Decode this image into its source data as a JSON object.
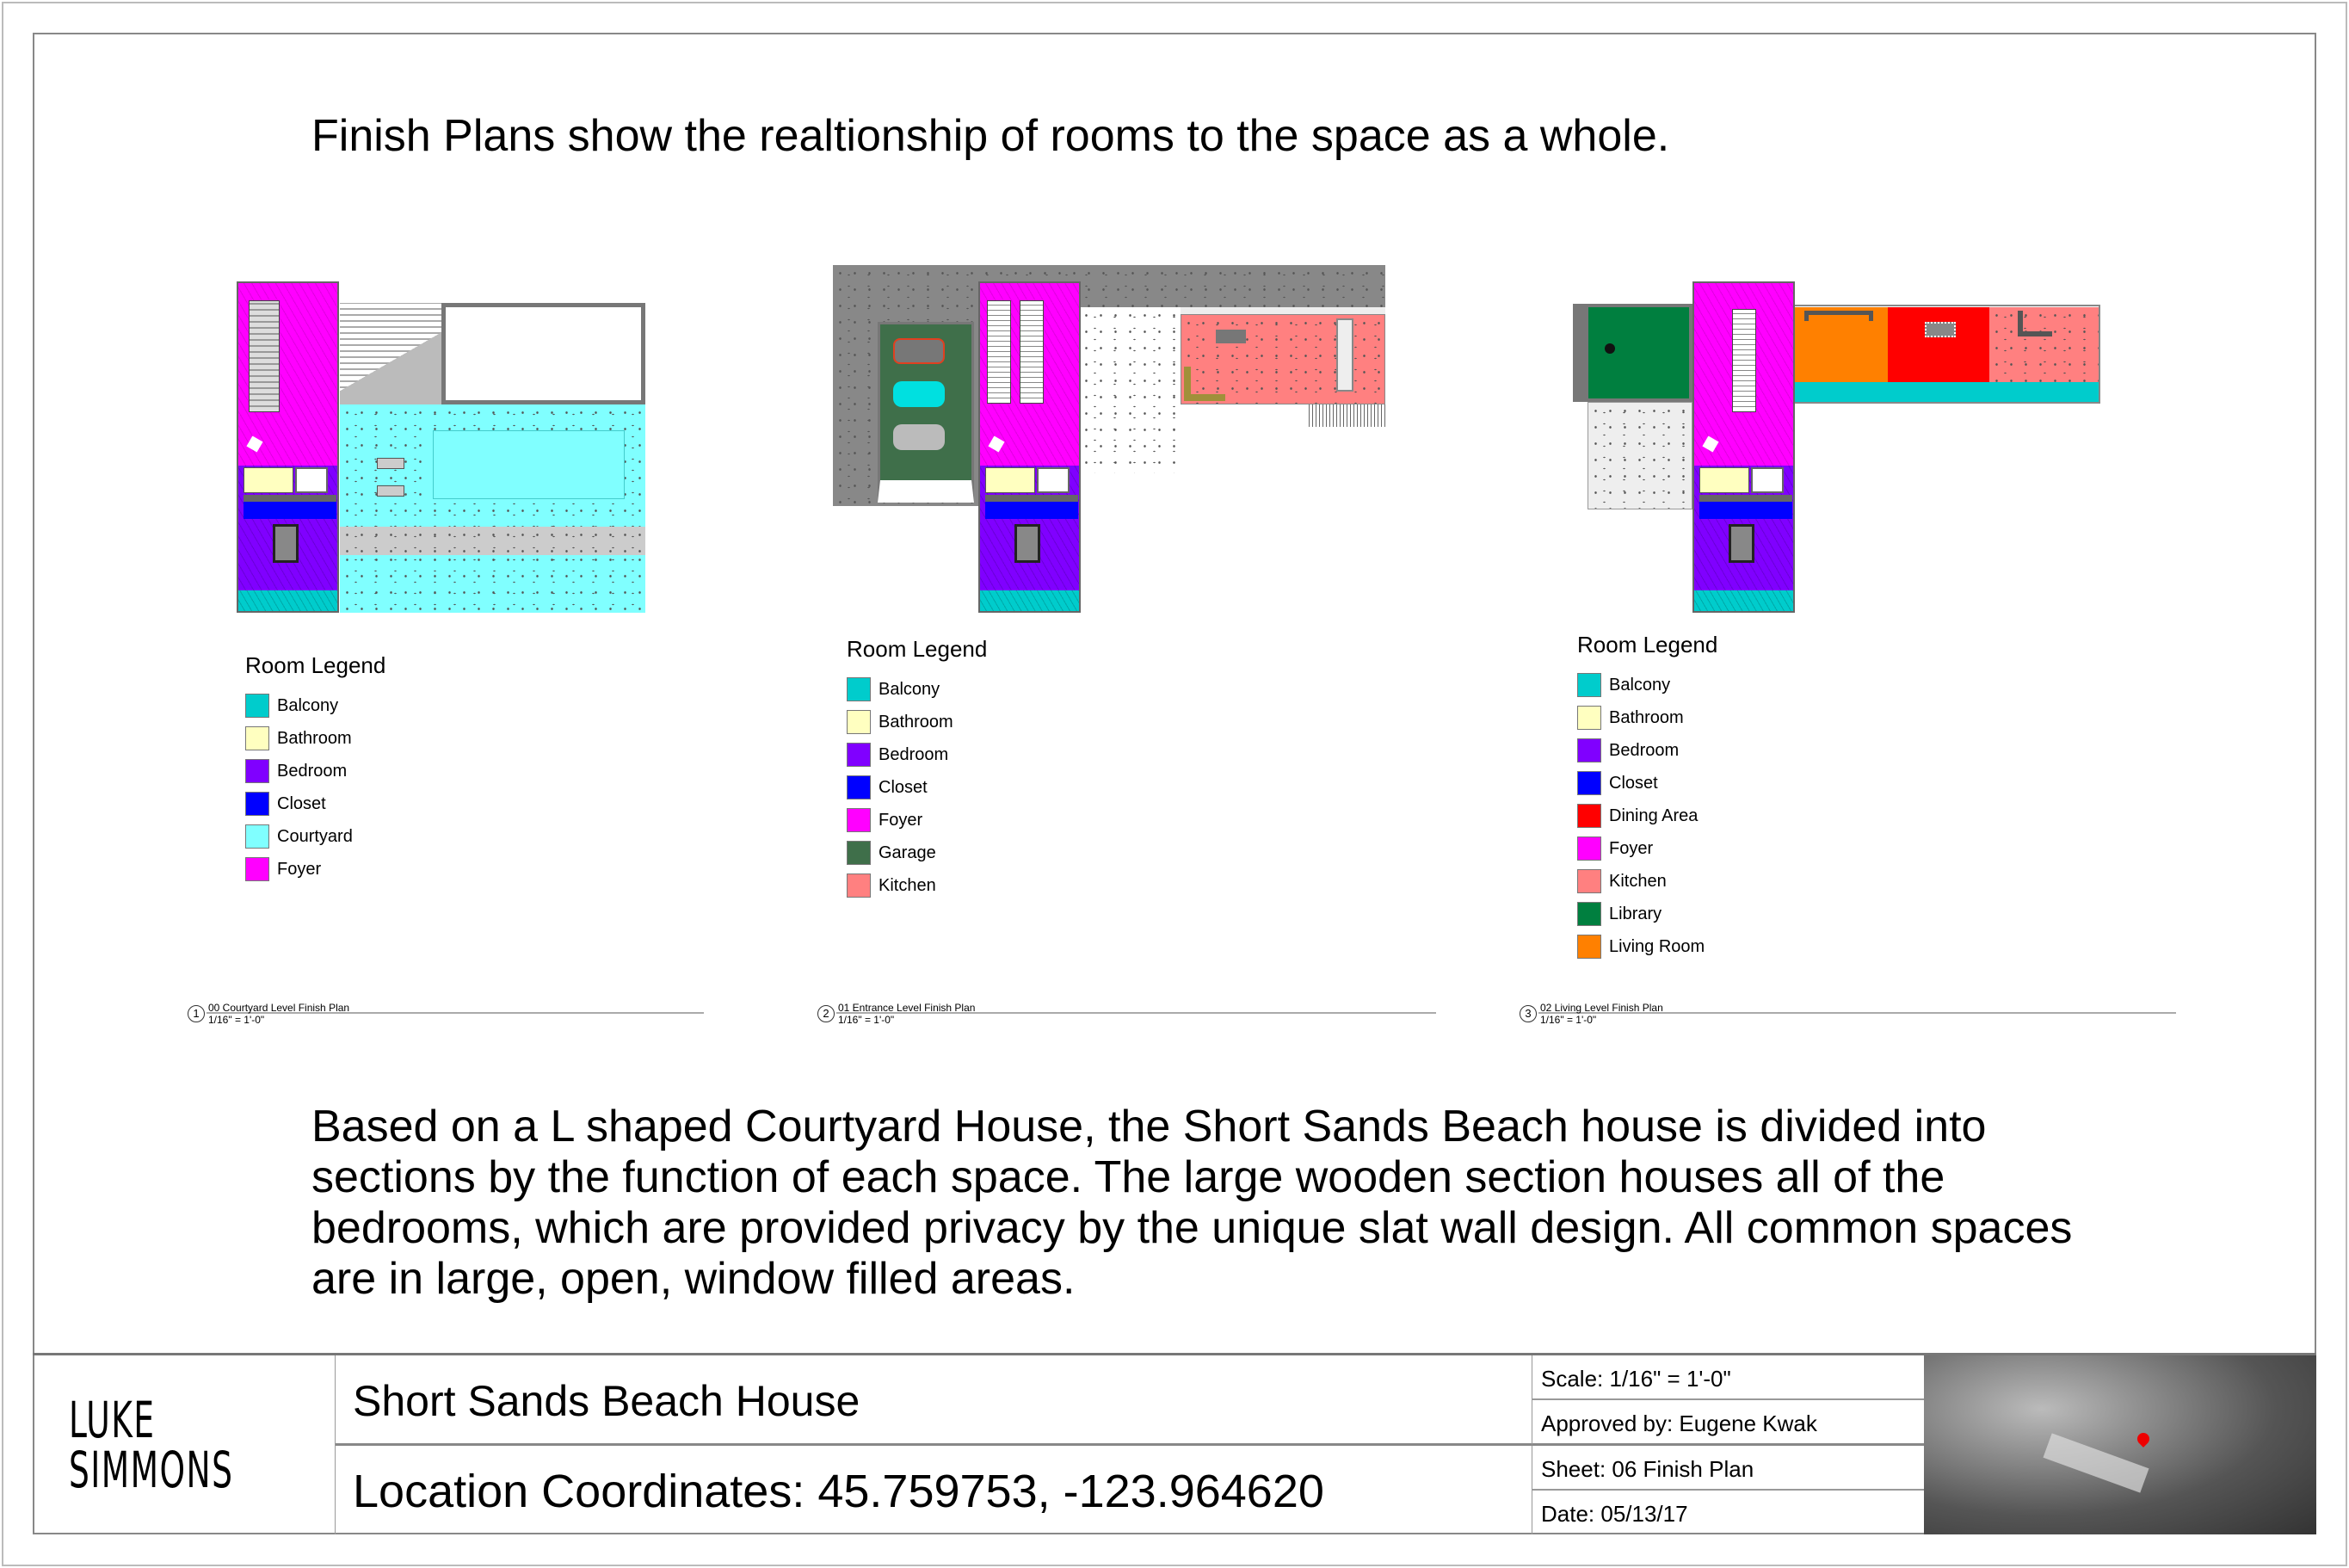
{
  "headline": "Finish Plans show the realtionship of rooms to the space as a whole.",
  "plans": [
    {
      "number": "1",
      "name": "00 Courtyard Level Finish Plan",
      "scale": "1/16\" = 1'-0\"",
      "legend_title": "Room Legend",
      "legend": [
        {
          "name": "Balcony",
          "color": "#00CCCC"
        },
        {
          "name": "Bathroom",
          "color": "#FFFFC0"
        },
        {
          "name": "Bedroom",
          "color": "#8000FF"
        },
        {
          "name": "Closet",
          "color": "#0000FF"
        },
        {
          "name": "Courtyard",
          "color": "#80FFFF"
        },
        {
          "name": "Foyer",
          "color": "#FF00FF"
        }
      ]
    },
    {
      "number": "2",
      "name": "01 Entrance Level Finish Plan",
      "scale": "1/16\" = 1'-0\"",
      "legend_title": "Room Legend",
      "legend": [
        {
          "name": "Balcony",
          "color": "#00CCCC"
        },
        {
          "name": "Bathroom",
          "color": "#FFFFC0"
        },
        {
          "name": "Bedroom",
          "color": "#8000FF"
        },
        {
          "name": "Closet",
          "color": "#0000FF"
        },
        {
          "name": "Foyer",
          "color": "#FF00FF"
        },
        {
          "name": "Garage",
          "color": "#3F6F4A"
        },
        {
          "name": "Kitchen",
          "color": "#FF8080"
        }
      ]
    },
    {
      "number": "3",
      "name": "02 Living Level Finish Plan",
      "scale": "1/16\" = 1'-0\"",
      "legend_title": "Room Legend",
      "legend": [
        {
          "name": "Balcony",
          "color": "#00CCCC"
        },
        {
          "name": "Bathroom",
          "color": "#FFFFC0"
        },
        {
          "name": "Bedroom",
          "color": "#8000FF"
        },
        {
          "name": "Closet",
          "color": "#0000FF"
        },
        {
          "name": "Dining Area",
          "color": "#FF0000"
        },
        {
          "name": "Foyer",
          "color": "#FF00FF"
        },
        {
          "name": "Kitchen",
          "color": "#FF8080"
        },
        {
          "name": "Library",
          "color": "#007F3F"
        },
        {
          "name": "Living Room",
          "color": "#FF8000"
        }
      ]
    }
  ],
  "description": "Based on a L shaped Courtyard House, the Short Sands Beach house is divided into sections by the function of each space. The large wooden section houses all of the bedrooms, which are provided privacy by the unique slat wall design. All common spaces are in large, open, window filled areas.",
  "title_block": {
    "logo_line1": "LUKE",
    "logo_line2": "SIMMONS",
    "project": "Short Sands Beach House",
    "location": "Location Coordinates: 45.759753, -123.964620",
    "scale": "Scale:  1/16\" = 1'-0\"",
    "approved": "Approved by:  Eugene Kwak",
    "sheet": "Sheet: 06 Finish Plan",
    "date": "Date:  05/13/17"
  }
}
